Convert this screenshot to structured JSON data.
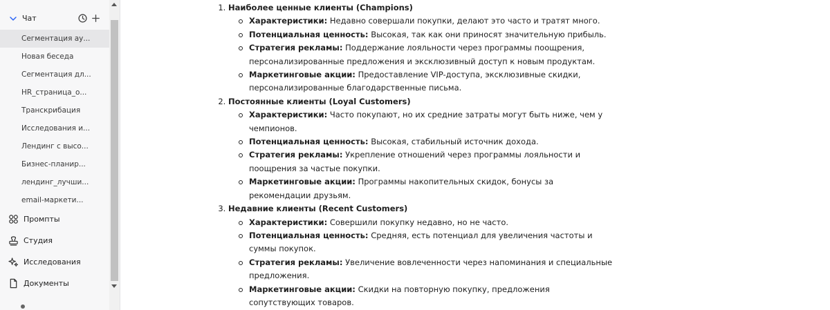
{
  "sidebar": {
    "chat_label": "Чат",
    "chats": [
      {
        "label": "Сегментация ау...",
        "active": true
      },
      {
        "label": "Новая беседа"
      },
      {
        "label": "Сегментация дл..."
      },
      {
        "label": "HR_страница_о..."
      },
      {
        "label": "Транскрибация"
      },
      {
        "label": "Исследования и..."
      },
      {
        "label": "Лендинг с высо..."
      },
      {
        "label": "Бизнес-планир..."
      },
      {
        "label": "лендинг_лучши..."
      },
      {
        "label": "email-маркети..."
      }
    ],
    "nav": [
      {
        "label": "Промпты",
        "icon": "grid-icon"
      },
      {
        "label": "Студия",
        "icon": "stamp-icon"
      },
      {
        "label": "Исследования",
        "icon": "sparkles-icon"
      },
      {
        "label": "Документы",
        "icon": "document-icon"
      }
    ]
  },
  "content": {
    "segments": [
      {
        "title": "Наиболее ценные клиенты (Champions)",
        "points": [
          {
            "label": "Характеристики:",
            "text": "Недавно совершали покупки, делают это часто и тратят много."
          },
          {
            "label": "Потенциальная ценность:",
            "text": "Высокая, так как они приносят значительную прибыль."
          },
          {
            "label": "Стратегия рекламы:",
            "text": "Поддержание лояльности через программы поощрения, персонализированные предложения и эксклюзивный доступ к новым продуктам."
          },
          {
            "label": "Маркетинговые акции:",
            "text": "Предоставление VIP-доступа, эксклюзивные скидки, персонализированные благодарственные письма."
          }
        ]
      },
      {
        "title": "Постоянные клиенты (Loyal Customers)",
        "points": [
          {
            "label": "Характеристики:",
            "text": "Часто покупают, но их средние затраты могут быть ниже, чем у чемпионов."
          },
          {
            "label": "Потенциальная ценность:",
            "text": "Высокая, стабильный источник дохода."
          },
          {
            "label": "Стратегия рекламы:",
            "text": "Укрепление отношений через программы лояльности и поощрения за частые покупки."
          },
          {
            "label": "Маркетинговые акции:",
            "text": "Программы накопительных скидок, бонусы за рекомендации друзьям."
          }
        ]
      },
      {
        "title": "Недавние клиенты (Recent Customers)",
        "points": [
          {
            "label": "Характеристики:",
            "text": "Совершили покупку недавно, но не часто."
          },
          {
            "label": "Потенциальная ценность:",
            "text": "Средняя, есть потенциал для увеличения частоты и суммы покупок."
          },
          {
            "label": "Стратегия рекламы:",
            "text": "Увеличение вовлеченности через напоминания и специальные предложения."
          },
          {
            "label": "Маркетинговые акции:",
            "text": "Скидки на повторную покупку, предложения сопутствующих товаров."
          }
        ]
      }
    ]
  },
  "colors": {
    "accent": "#2a64f6",
    "sidebar_bg": "#f7f7f8",
    "active_item_bg": "#e6e6e8"
  }
}
